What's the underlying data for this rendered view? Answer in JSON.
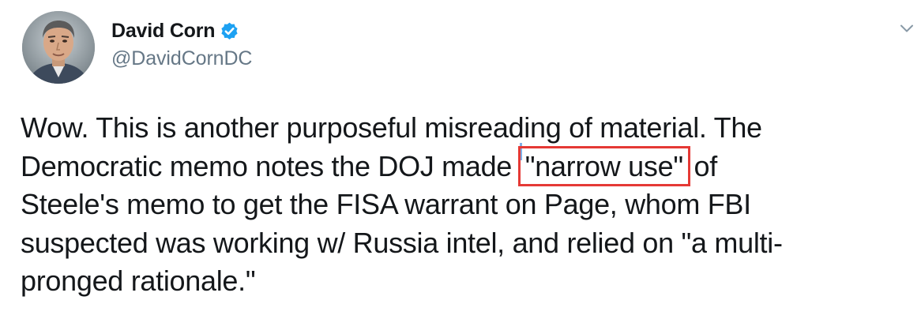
{
  "user": {
    "display_name": "David Corn",
    "handle": "@DavidCornDC",
    "verified": true
  },
  "icons": {
    "verified": "verified-badge-icon",
    "menu": "chevron-down-icon"
  },
  "colors": {
    "verified_blue": "#1da1f2",
    "handle_gray": "#657786",
    "highlight_box": "#e53935"
  },
  "tweet": {
    "line1": "Wow. This is another purposeful misreading of material. The",
    "line2_before": "Democratic memo notes the DOJ made ",
    "line2_highlight": "\"narrow use\"",
    "line2_after": " of",
    "line3": "Steele's memo to get the FISA warrant on Page, whom FBI",
    "line4": "suspected was working w/ Russia intel, and relied on \"a multi-",
    "line5": "pronged rationale.\""
  }
}
